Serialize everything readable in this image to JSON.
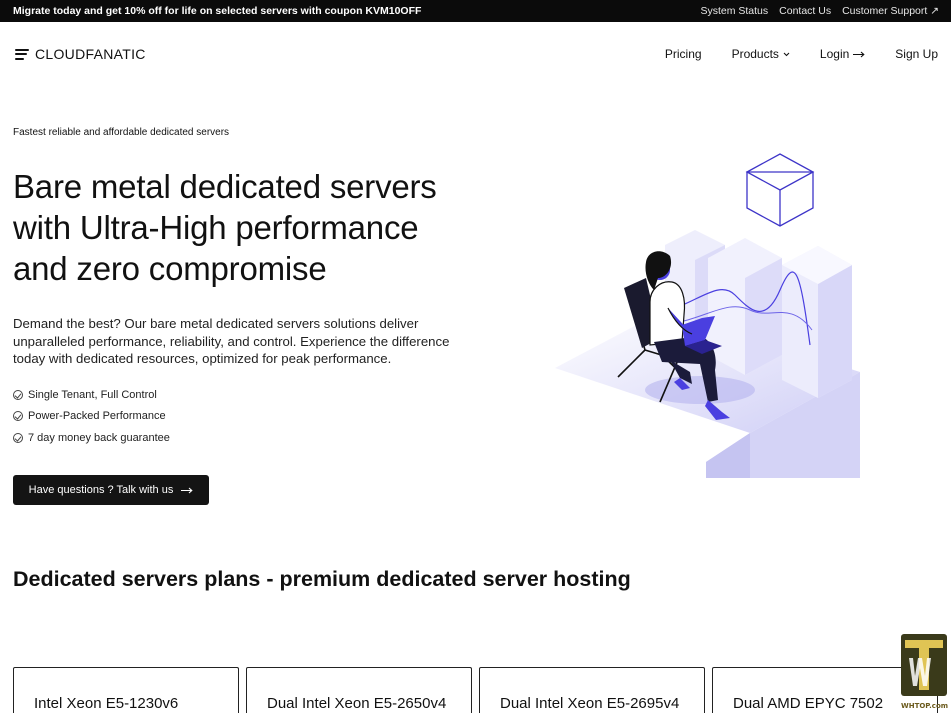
{
  "topbar": {
    "promo": "Migrate today and get 10% off for life on selected servers with coupon KVM10OFF",
    "links": [
      "System Status",
      "Contact Us",
      "Customer Support ↗"
    ]
  },
  "brand": {
    "name": "CLOUDFANATIC",
    "icon": "menu-lines-icon"
  },
  "nav": {
    "pricing": "Pricing",
    "products": "Products",
    "login": "Login",
    "signup": "Sign Up"
  },
  "hero": {
    "eyebrow": "Fastest reliable and affordable dedicated servers",
    "title_lines": [
      "Bare metal dedicated servers",
      "with Ultra-High performance",
      "and zero compromise"
    ],
    "description": "Demand the best? Our bare metal dedicated servers solutions deliver unparalleled performance, reliability, and control. Experience the difference today with dedicated resources, optimized for peak performance.",
    "features": [
      "Single Tenant, Full Control",
      "Power-Packed Performance",
      "7 day money back guarantee"
    ],
    "cta": "Have questions ? Talk with us"
  },
  "plans": {
    "heading": "Dedicated servers plans - premium dedicated server hosting",
    "cards": [
      "Intel Xeon E5-1230v6",
      "Dual Intel Xeon E5-2650v4",
      "Dual Intel Xeon E5-2695v4",
      "Dual AMD EPYC 7502"
    ]
  },
  "watermark": {
    "text": "WHTOP.com"
  },
  "colors": {
    "accent": "#4a3fe0",
    "illustration_light": "#e4e4fb",
    "illustration_mid": "#c9c8f4",
    "dark": "#111111"
  }
}
